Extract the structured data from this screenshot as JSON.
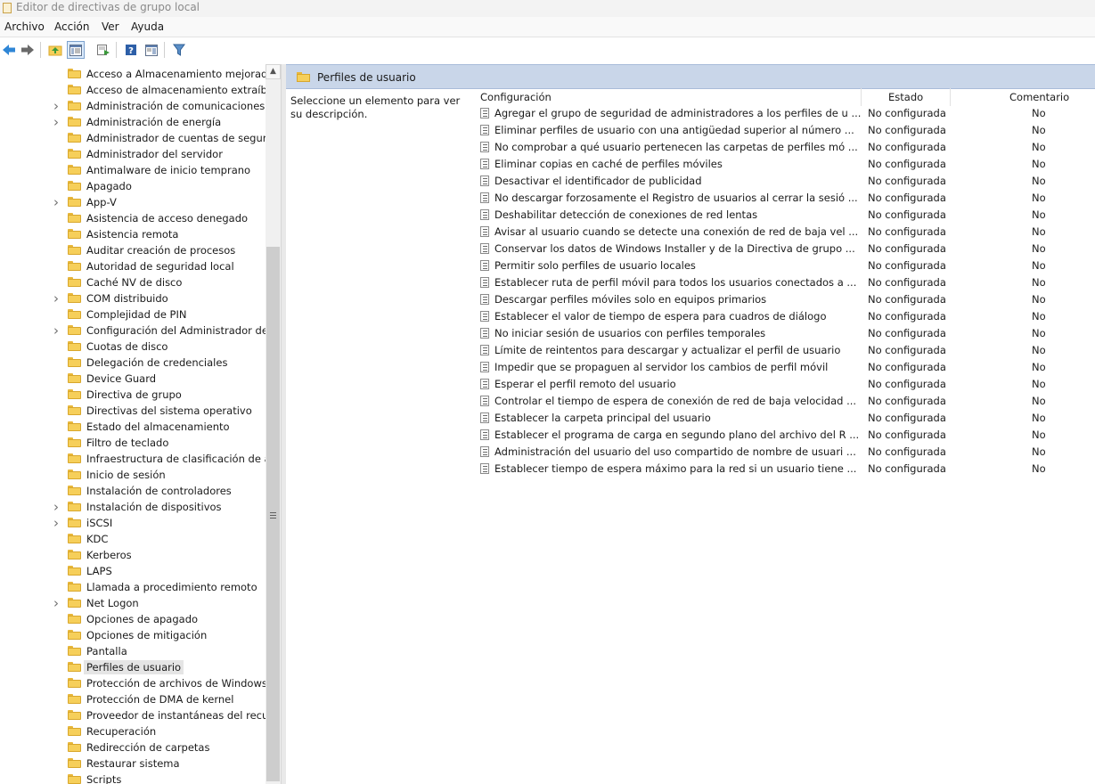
{
  "window": {
    "title": "Editor de directivas de grupo local"
  },
  "menu": [
    "Archivo",
    "Acción",
    "Ver",
    "Ayuda"
  ],
  "toolbar": {
    "buttons": [
      "back-icon",
      "forward-icon",
      "up-folder-icon",
      "show-hide-tree-icon",
      "export-list-icon",
      "help-icon",
      "properties-view-icon",
      "filter-icon"
    ]
  },
  "tree": {
    "items": [
      {
        "label": "Acceso a Almacenamiento mejorado",
        "expandable": false
      },
      {
        "label": "Acceso de almacenamiento extraíble",
        "expandable": false
      },
      {
        "label": "Administración de comunicaciones de",
        "expandable": true
      },
      {
        "label": "Administración de energía",
        "expandable": true
      },
      {
        "label": "Administrador de cuentas de segurida",
        "expandable": false
      },
      {
        "label": "Administrador del servidor",
        "expandable": false
      },
      {
        "label": "Antimalware de inicio temprano",
        "expandable": false
      },
      {
        "label": "Apagado",
        "expandable": false
      },
      {
        "label": "App-V",
        "expandable": true
      },
      {
        "label": "Asistencia de acceso denegado",
        "expandable": false
      },
      {
        "label": "Asistencia remota",
        "expandable": false
      },
      {
        "label": "Auditar creación de procesos",
        "expandable": false
      },
      {
        "label": "Autoridad de seguridad local",
        "expandable": false
      },
      {
        "label": "Caché NV de disco",
        "expandable": false
      },
      {
        "label": "COM distribuido",
        "expandable": true
      },
      {
        "label": "Complejidad de PIN",
        "expandable": false
      },
      {
        "label": "Configuración del Administrador de c",
        "expandable": true
      },
      {
        "label": "Cuotas de disco",
        "expandable": false
      },
      {
        "label": "Delegación de credenciales",
        "expandable": false
      },
      {
        "label": "Device Guard",
        "expandable": false
      },
      {
        "label": "Directiva de grupo",
        "expandable": false
      },
      {
        "label": "Directivas del sistema operativo",
        "expandable": false
      },
      {
        "label": "Estado del almacenamiento",
        "expandable": false
      },
      {
        "label": "Filtro de teclado",
        "expandable": false
      },
      {
        "label": "Infraestructura de clasificación de arch",
        "expandable": false
      },
      {
        "label": "Inicio de sesión",
        "expandable": false
      },
      {
        "label": "Instalación de controladores",
        "expandable": false
      },
      {
        "label": "Instalación de dispositivos",
        "expandable": true
      },
      {
        "label": "iSCSI",
        "expandable": true
      },
      {
        "label": "KDC",
        "expandable": false
      },
      {
        "label": "Kerberos",
        "expandable": false
      },
      {
        "label": "LAPS",
        "expandable": false
      },
      {
        "label": "Llamada a procedimiento remoto",
        "expandable": false
      },
      {
        "label": "Net Logon",
        "expandable": true
      },
      {
        "label": "Opciones de apagado",
        "expandable": false
      },
      {
        "label": "Opciones de mitigación",
        "expandable": false
      },
      {
        "label": "Pantalla",
        "expandable": false
      },
      {
        "label": "Perfiles de usuario",
        "expandable": false,
        "selected": true
      },
      {
        "label": "Protección de archivos de Windows",
        "expandable": false
      },
      {
        "label": "Protección de DMA de kernel",
        "expandable": false
      },
      {
        "label": "Proveedor de instantáneas del recurso",
        "expandable": false
      },
      {
        "label": "Recuperación",
        "expandable": false
      },
      {
        "label": "Redirección de carpetas",
        "expandable": false
      },
      {
        "label": "Restaurar sistema",
        "expandable": false
      },
      {
        "label": "Scripts",
        "expandable": false
      }
    ]
  },
  "right": {
    "header_title": "Perfiles de usuario",
    "description": "Seleccione un elemento para ver su descripción.",
    "columns": [
      "Configuración",
      "Estado",
      "Comentario"
    ],
    "rows": [
      {
        "name": "Agregar el grupo de seguridad de administradores a los perfiles de usuarios móviles",
        "state": "No configurada",
        "comment": "No"
      },
      {
        "name": "Eliminar perfiles de usuario con una antigüedad superior al número de días especificado",
        "state": "No configurada",
        "comment": "No"
      },
      {
        "name": "No comprobar a qué usuario pertenecen las carpetas de perfiles móviles",
        "state": "No configurada",
        "comment": "No"
      },
      {
        "name": "Eliminar copias en caché de perfiles móviles",
        "state": "No configurada",
        "comment": "No"
      },
      {
        "name": "Desactivar el identificador de publicidad",
        "state": "No configurada",
        "comment": "No"
      },
      {
        "name": "No descargar forzosamente el Registro de usuarios al cerrar la sesión de usuario",
        "state": "No configurada",
        "comment": "No"
      },
      {
        "name": "Deshabilitar detección de conexiones de red lentas",
        "state": "No configurada",
        "comment": "No"
      },
      {
        "name": "Avisar al usuario cuando se detecte una conexión de red de baja velocidad",
        "state": "No configurada",
        "comment": "No"
      },
      {
        "name": "Conservar los datos de Windows Installer y de la Directiva de grupo de instalación",
        "state": "No configurada",
        "comment": "No"
      },
      {
        "name": "Permitir solo perfiles de usuario locales",
        "state": "No configurada",
        "comment": "No"
      },
      {
        "name": "Establecer ruta de perfil móvil para todos los usuarios conectados a este equipo",
        "state": "No configurada",
        "comment": "No"
      },
      {
        "name": "Descargar perfiles móviles solo en equipos primarios",
        "state": "No configurada",
        "comment": "No"
      },
      {
        "name": "Establecer el valor de tiempo de espera para cuadros de diálogo",
        "state": "No configurada",
        "comment": "No"
      },
      {
        "name": "No iniciar sesión de usuarios con perfiles temporales",
        "state": "No configurada",
        "comment": "No"
      },
      {
        "name": "Límite de reintentos para descargar y actualizar el perfil de usuario",
        "state": "No configurada",
        "comment": "No"
      },
      {
        "name": "Impedir que se propaguen al servidor los cambios de perfil móvil",
        "state": "No configurada",
        "comment": "No"
      },
      {
        "name": "Esperar el perfil remoto del usuario",
        "state": "No configurada",
        "comment": "No"
      },
      {
        "name": "Controlar el tiempo de espera de conexión de red de baja velocidad para los perfiles",
        "state": "No configurada",
        "comment": "No"
      },
      {
        "name": "Establecer la carpeta principal del usuario",
        "state": "No configurada",
        "comment": "No"
      },
      {
        "name": "Establecer el programa de carga en segundo plano del archivo del Registro del usuario",
        "state": "No configurada",
        "comment": "No"
      },
      {
        "name": "Administración del usuario del uso compartido de nombre de usuario, imagen de cuenta",
        "state": "No configurada",
        "comment": "No"
      },
      {
        "name": "Establecer tiempo de espera máximo para la red si un usuario tiene un perfil móvil",
        "state": "No configurada",
        "comment": "No"
      }
    ]
  }
}
